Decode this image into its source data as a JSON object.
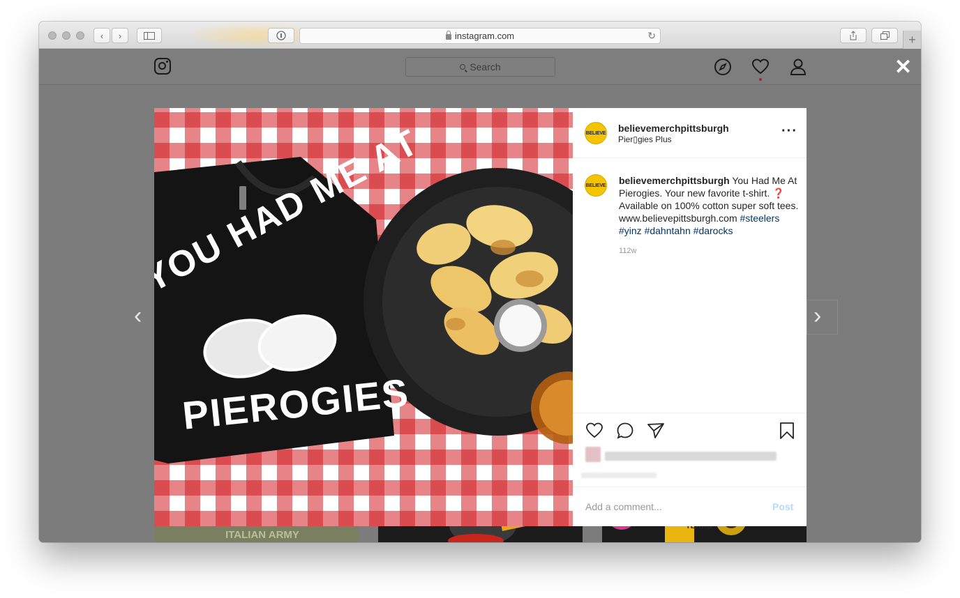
{
  "browser": {
    "url": "instagram.com"
  },
  "instagram": {
    "search_placeholder": "Search",
    "close_symbol": "✕",
    "prev_symbol": "‹",
    "next_symbol": "›"
  },
  "post": {
    "username": "believemerchpittsburgh",
    "location": "Pier▯gies Plus",
    "avatar_text": "BELIEVE",
    "caption_text": " You Had Me At Pierogies. Your new favorite t-shirt. ❓ Available on 100% cotton super soft tees. www.believepittsburgh.com",
    "hashtags": [
      "#steelers",
      "#yinz",
      "#dahntahn",
      "#darocks"
    ],
    "age": "112w",
    "comment_placeholder": "Add a comment...",
    "post_label": "Post",
    "image": {
      "shirt_line1": "YOU HAD ME AT",
      "shirt_line2": "PIEROGIES"
    }
  },
  "thumbnails": [
    {
      "text": "FRANCO'S ITALIAN ARMY"
    },
    {
      "text": ""
    },
    {
      "text": "HATE TEARS"
    }
  ],
  "colors": {
    "gingham_red": "#d21e24",
    "tag_blue": "#003569",
    "post_button": "#b3dbff",
    "avatar_yellow": "#f5c400"
  }
}
